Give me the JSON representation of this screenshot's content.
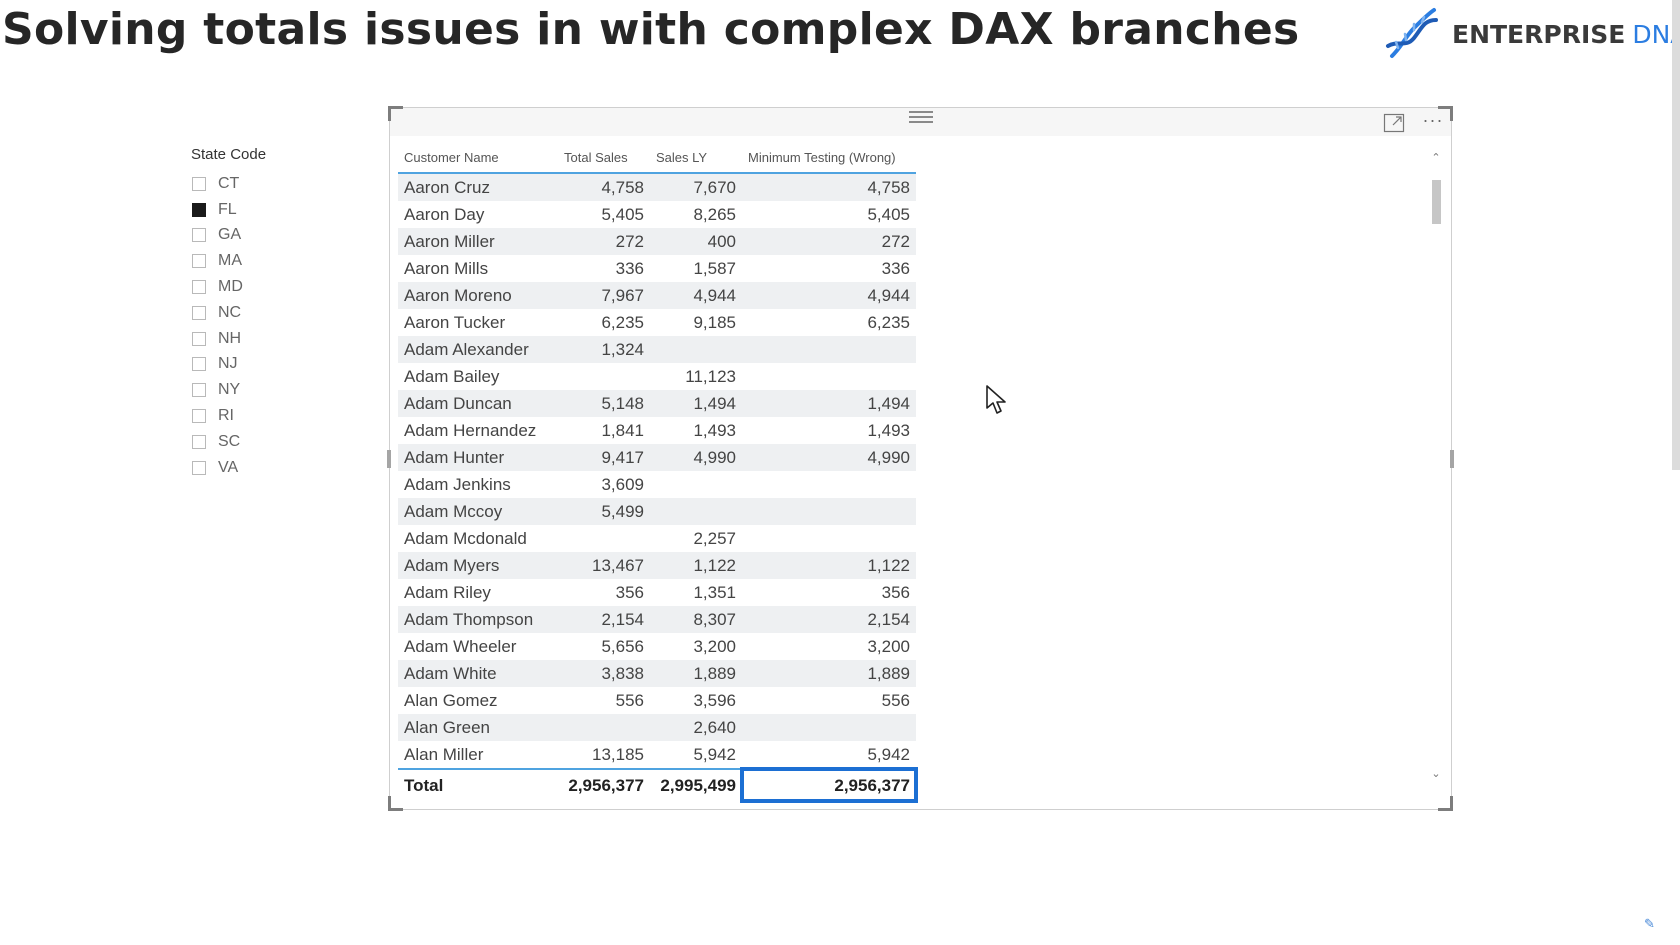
{
  "page": {
    "title": "Solving totals issues in with complex DAX branches",
    "logo": {
      "word1": "ENTERPRISE",
      "word2": "DNA",
      "icon": "dna-helix-icon"
    }
  },
  "slicer": {
    "title": "State Code",
    "items": [
      {
        "label": "CT",
        "checked": false
      },
      {
        "label": "FL",
        "checked": true
      },
      {
        "label": "GA",
        "checked": false
      },
      {
        "label": "MA",
        "checked": false
      },
      {
        "label": "MD",
        "checked": false
      },
      {
        "label": "NC",
        "checked": false
      },
      {
        "label": "NH",
        "checked": false
      },
      {
        "label": "NJ",
        "checked": false
      },
      {
        "label": "NY",
        "checked": false
      },
      {
        "label": "RI",
        "checked": false
      },
      {
        "label": "SC",
        "checked": false
      },
      {
        "label": "VA",
        "checked": false
      }
    ]
  },
  "visual": {
    "icons": {
      "focus": "focus-mode-icon",
      "more": "more-options-icon",
      "drag": "drag-grip-icon"
    },
    "more_label": "···",
    "columns": [
      "Customer Name",
      "Total Sales",
      "Sales LY",
      "Minimum Testing (Wrong)"
    ],
    "rows": [
      [
        "Aaron Cruz",
        "4,758",
        "7,670",
        "4,758"
      ],
      [
        "Aaron Day",
        "5,405",
        "8,265",
        "5,405"
      ],
      [
        "Aaron Miller",
        "272",
        "400",
        "272"
      ],
      [
        "Aaron Mills",
        "336",
        "1,587",
        "336"
      ],
      [
        "Aaron Moreno",
        "7,967",
        "4,944",
        "4,944"
      ],
      [
        "Aaron Tucker",
        "6,235",
        "9,185",
        "6,235"
      ],
      [
        "Adam Alexander",
        "1,324",
        "",
        ""
      ],
      [
        "Adam Bailey",
        "",
        "11,123",
        ""
      ],
      [
        "Adam Duncan",
        "5,148",
        "1,494",
        "1,494"
      ],
      [
        "Adam Hernandez",
        "1,841",
        "1,493",
        "1,493"
      ],
      [
        "Adam Hunter",
        "9,417",
        "4,990",
        "4,990"
      ],
      [
        "Adam Jenkins",
        "3,609",
        "",
        ""
      ],
      [
        "Adam Mccoy",
        "5,499",
        "",
        ""
      ],
      [
        "Adam Mcdonald",
        "",
        "2,257",
        ""
      ],
      [
        "Adam Myers",
        "13,467",
        "1,122",
        "1,122"
      ],
      [
        "Adam Riley",
        "356",
        "1,351",
        "356"
      ],
      [
        "Adam Thompson",
        "2,154",
        "8,307",
        "2,154"
      ],
      [
        "Adam Wheeler",
        "5,656",
        "3,200",
        "3,200"
      ],
      [
        "Adam White",
        "3,838",
        "1,889",
        "1,889"
      ],
      [
        "Alan Gomez",
        "556",
        "3,596",
        "556"
      ],
      [
        "Alan Green",
        "",
        "2,640",
        ""
      ],
      [
        "Alan Miller",
        "13,185",
        "5,942",
        "5,942"
      ]
    ],
    "total": [
      "Total",
      "2,956,377",
      "2,995,499",
      "2,956,377"
    ],
    "highlight_color": "#1c6fd3"
  },
  "colors": {
    "accent": "#2b7de1",
    "header_rule": "#4fa3e0",
    "band": "#eef0f2"
  }
}
